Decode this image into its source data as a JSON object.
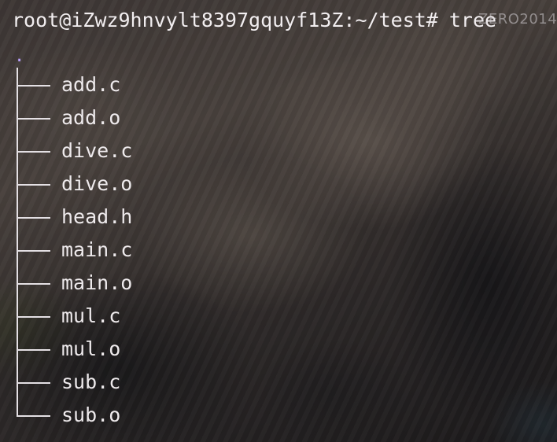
{
  "terminal": {
    "prompt": "root@iZwz9hnvylt8397gquyf13Z:~/test#",
    "command": "tree",
    "overlay_text": "ZERO2014.",
    "root": ".",
    "entries": [
      "add.c",
      "add.o",
      "dive.c",
      "dive.o",
      "head.h",
      "main.c",
      "main.o",
      "mul.c",
      "mul.o",
      "sub.c",
      "sub.o"
    ]
  },
  "colors": {
    "text": "#eeeaec",
    "root_dot": "#b9a0ff"
  }
}
